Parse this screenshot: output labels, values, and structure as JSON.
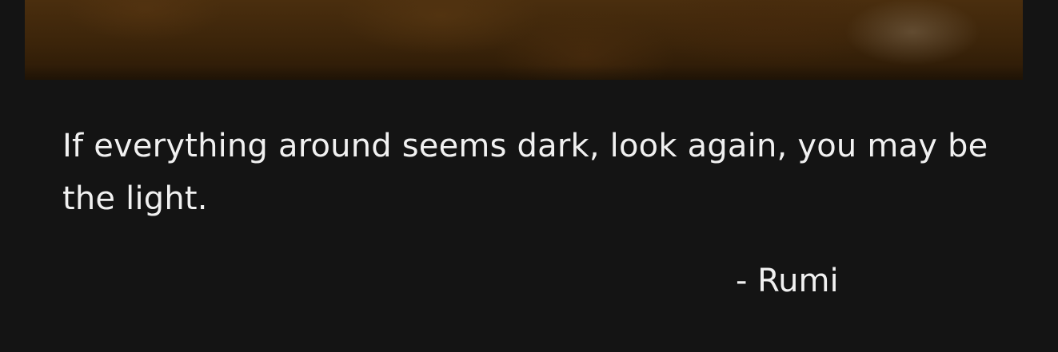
{
  "photo": {
    "icon": "photo-image",
    "tone": "#3b240a"
  },
  "quote": {
    "text": "If everything around seems dark, look again, you may be the light.",
    "author": "- Rumi"
  },
  "colors": {
    "background": "#141414",
    "text": "#f1f1f1"
  }
}
